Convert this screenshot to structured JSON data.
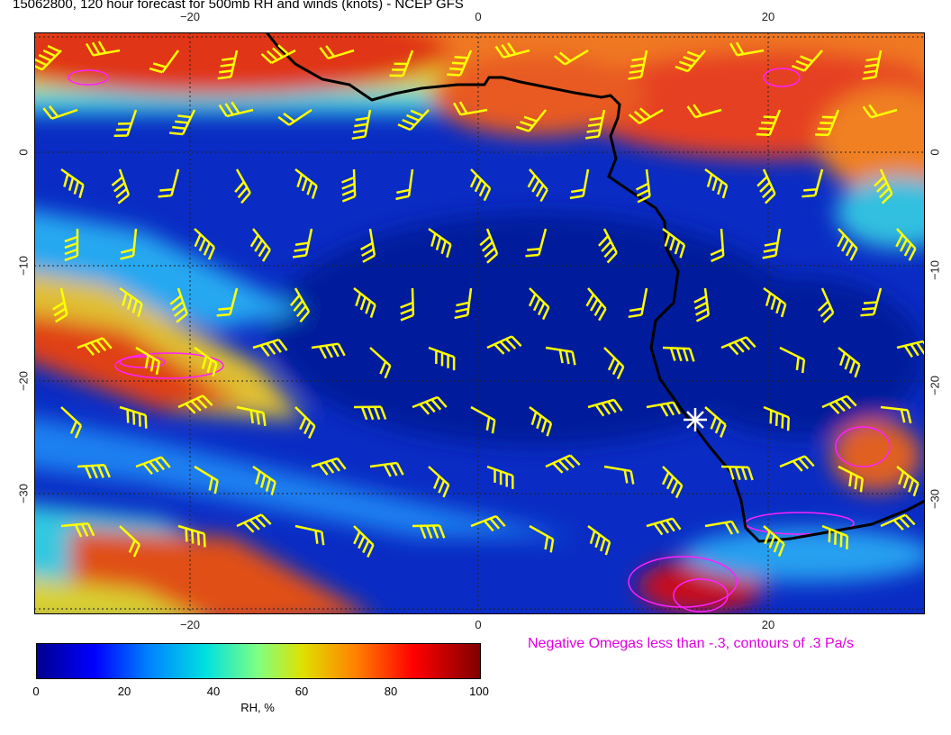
{
  "title": "15062800, 120 hour forecast for 500mb RH and winds (knots) - NCEP GFS",
  "axes": {
    "lon_ticks": [
      "−20",
      "0",
      "20"
    ],
    "lat_ticks": [
      "0",
      "−10",
      "−20",
      "−30"
    ]
  },
  "omega_note": "Negative Omegas less than -.3, contours of .3 Pa/s",
  "colorbar": {
    "ticks": [
      "0",
      "20",
      "40",
      "60",
      "80",
      "100"
    ],
    "label": "RH, %"
  },
  "colors": {
    "barb": "#ffff00",
    "omega": "#ff20ff",
    "coast": "#000000",
    "marker": "#ffffff"
  },
  "chart_data": {
    "type": "heatmap",
    "variable": "RH",
    "unit": "%",
    "lon_range": [
      -31,
      31
    ],
    "lat_range": [
      9,
      -41
    ],
    "grid": true
  }
}
